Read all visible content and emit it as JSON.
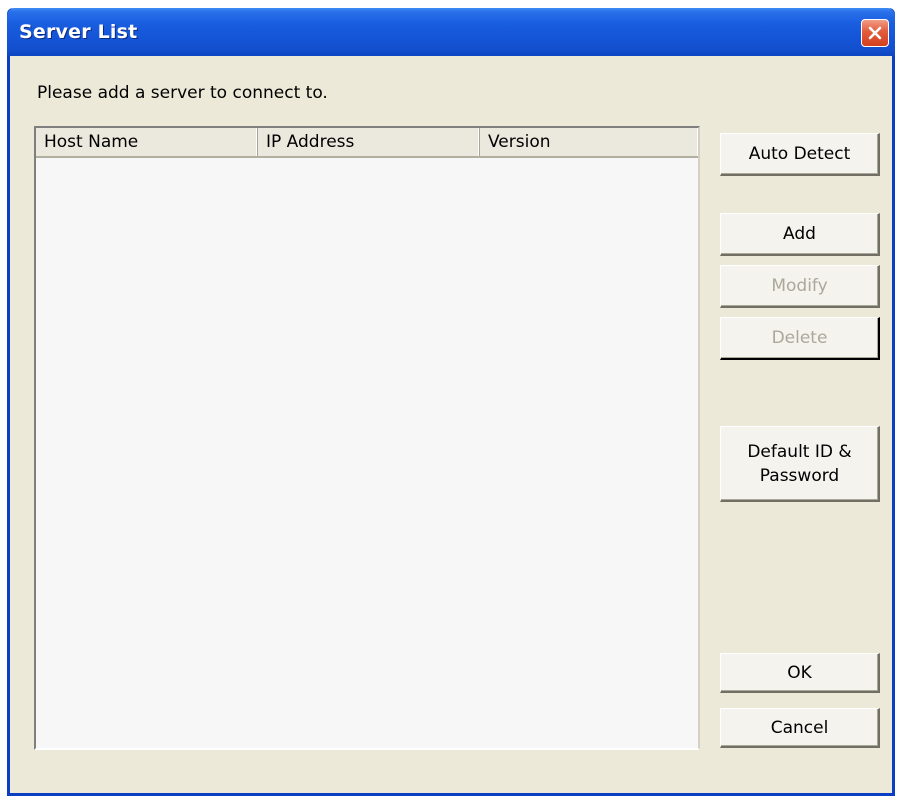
{
  "window": {
    "title": "Server List",
    "close_icon": "close-icon"
  },
  "prompt": "Please add a server to connect to.",
  "list": {
    "columns": [
      "Host Name",
      "IP Address",
      "Version"
    ],
    "rows": []
  },
  "buttons": {
    "auto_detect": "Auto Detect",
    "add": "Add",
    "modify": "Modify",
    "delete": "Delete",
    "default_id_password": "Default ID & Password",
    "ok": "OK",
    "cancel": "Cancel"
  },
  "button_states": {
    "modify_enabled": false,
    "delete_enabled": false
  },
  "colors": {
    "titlebar": "#1555d8",
    "dialog_bg": "#ece9d8",
    "close_button": "#e25b3b",
    "disabled_text": "#aca899"
  }
}
